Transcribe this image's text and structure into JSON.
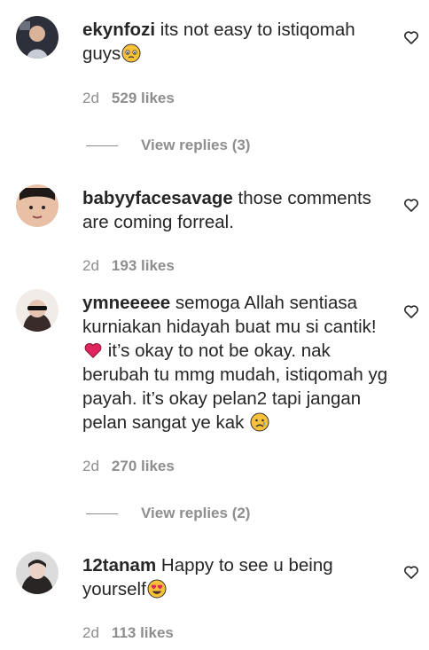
{
  "comments": [
    {
      "username": "ekynfozi",
      "text": "its not easy to istiqomah guys",
      "emoji": "pleading-face-emoji",
      "time": "2d",
      "likes": "529 likes",
      "view_replies": "View replies (3)"
    },
    {
      "username": "babyyfacesavage",
      "text": "those comments are coming forreal.",
      "time": "2d",
      "likes": "193 likes"
    },
    {
      "username": "ymneeeee",
      "text_part1": "semoga Allah sentiasa kurniakan hidayah buat mu si cantik!",
      "text_part2": "it’s okay to not be okay. nak berubah tu mmg mudah, istiqomah yg payah. it’s okay pelan2 tapi jangan pelan sangat ye kak",
      "emoji1": "red-heart-emoji",
      "emoji2": "sad-face-emoji",
      "time": "2d",
      "likes": "270 likes",
      "view_replies": "View replies (2)"
    },
    {
      "username": "12tanam",
      "text": "Happy to see u being yourself",
      "emoji": "heart-eyes-emoji",
      "time": "2d",
      "likes": "113 likes"
    }
  ],
  "colors": {
    "text": "#262626",
    "secondary": "#8e8e8e",
    "heart_red": "#e0245e",
    "emoji_yellow": "#f7c23a"
  }
}
